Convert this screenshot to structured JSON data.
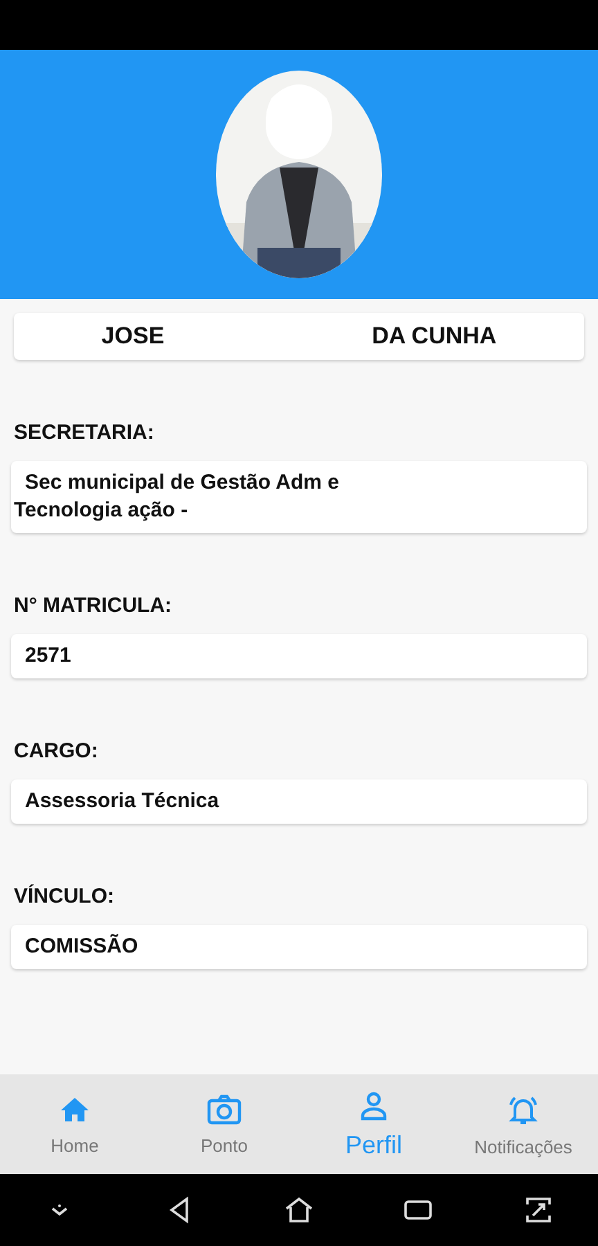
{
  "name_parts": [
    "JOSE",
    "DA CUNHA"
  ],
  "fields": [
    {
      "label": "SECRETARIA:",
      "value_lines": [
        "Sec municipal de Gestão Adm e",
        "Tecnologia ação -"
      ]
    },
    {
      "label": "N° MATRICULA:",
      "value_lines": [
        "2571"
      ]
    },
    {
      "label": "CARGO:",
      "value_lines": [
        "Assessoria Técnica"
      ]
    },
    {
      "label": "VÍNCULO:",
      "value_lines": [
        "COMISSÃO"
      ]
    }
  ],
  "bottom_nav": [
    {
      "label": "Home",
      "selected": false
    },
    {
      "label": "Ponto",
      "selected": false
    },
    {
      "label": "Perfil",
      "selected": true
    },
    {
      "label": "Notificações",
      "selected": false
    }
  ]
}
